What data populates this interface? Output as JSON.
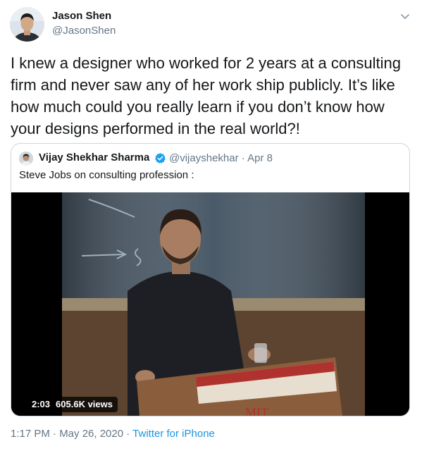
{
  "colors": {
    "accent": "#1b95e0",
    "verified": "#1da1f2",
    "text_primary": "#14171a",
    "text_secondary": "#657786",
    "border": "#ccd6dd"
  },
  "tweet": {
    "author": {
      "name": "Jason Shen",
      "handle": "@JasonShen"
    },
    "menu_icon": "chevron-down-icon",
    "text": "I knew a designer who worked for 2 years at a consulting firm and never saw any of her work ship publicly. It’s like how much could you really learn if you don’t know how your designs performed in the real world?!",
    "quoted": {
      "author_name": "Vijay Shekhar Sharma",
      "verified_icon": "verified-badge-icon",
      "handle_date": "@vijayshekhar · Apr 8",
      "text": "Steve Jobs on consulting profession :",
      "video": {
        "duration": "2:03",
        "views": "605.6K views",
        "banner_text": "MIT"
      }
    },
    "meta": {
      "time_date": "1:17 PM · May 26, 2020 · ",
      "source": "Twitter for iPhone"
    }
  }
}
